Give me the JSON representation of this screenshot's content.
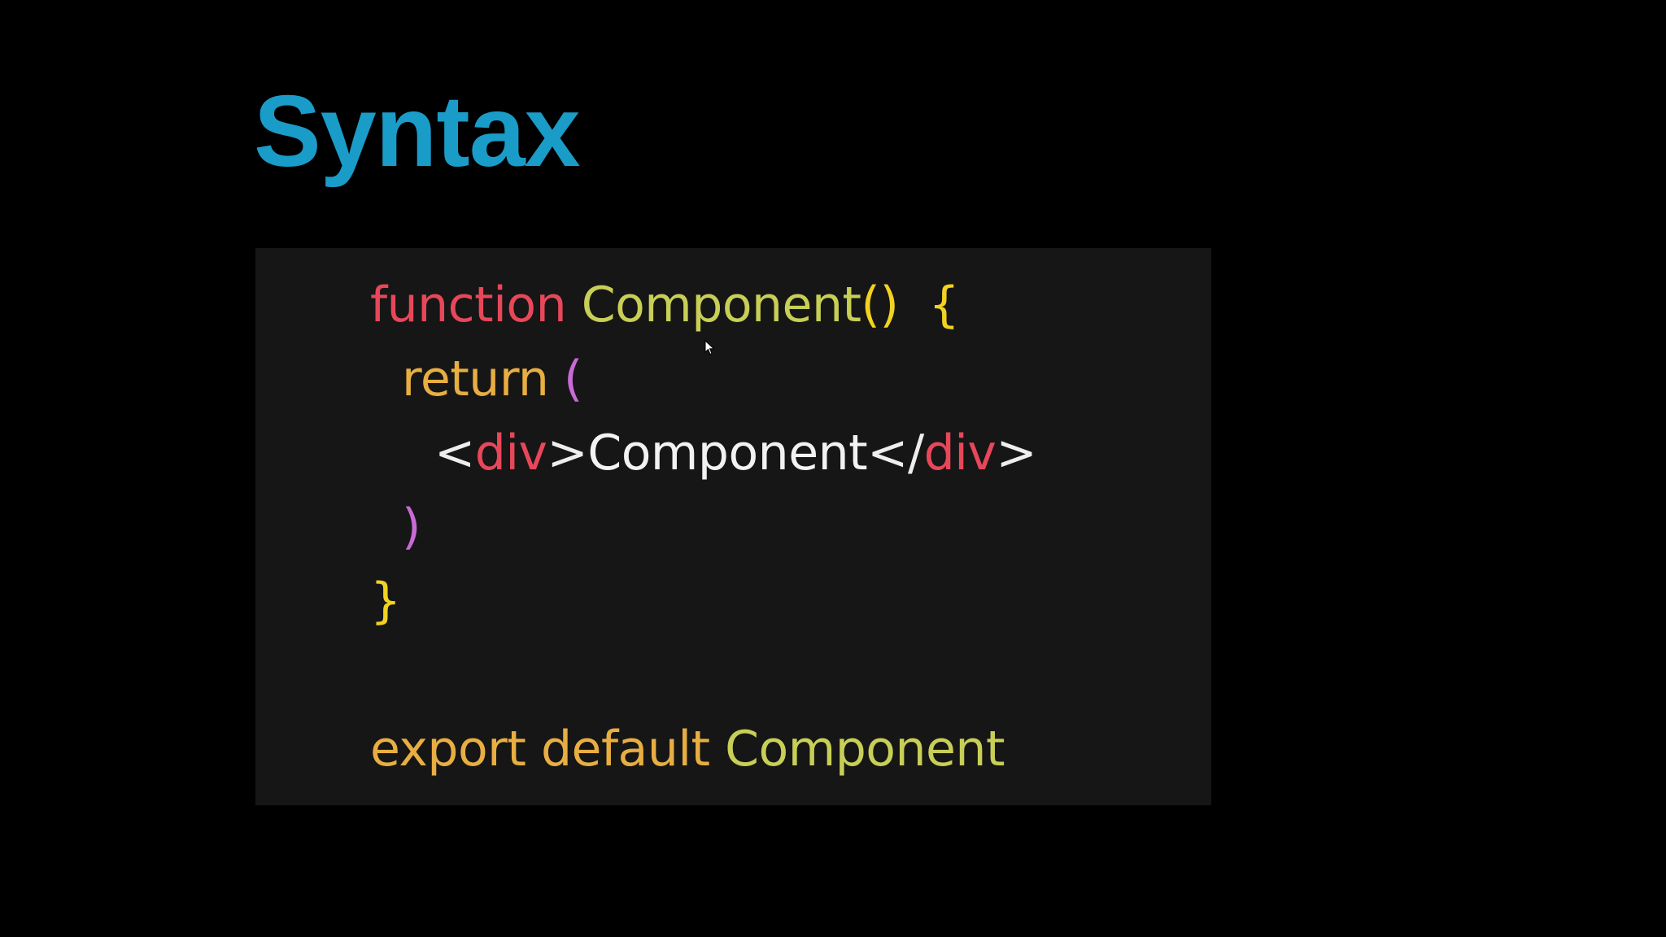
{
  "slide": {
    "title": "Syntax"
  },
  "code": {
    "lines": [
      {
        "tokens": [
          {
            "text": "function",
            "color": "#e8475a"
          },
          {
            "text": " ",
            "color": "#ffffff"
          },
          {
            "text": "Component",
            "color": "#c8cf56"
          },
          {
            "text": "()",
            "color": "#f2d221"
          },
          {
            "text": "  ",
            "color": "#ffffff"
          },
          {
            "text": "{",
            "color": "#f2d221"
          }
        ]
      },
      {
        "tokens": [
          {
            "text": "return",
            "color": "#e8ae42"
          },
          {
            "text": " ",
            "color": "#ffffff"
          },
          {
            "text": "(",
            "color": "#c96ad6"
          }
        ]
      },
      {
        "tokens": [
          {
            "text": "<",
            "color": "#eeeeee"
          },
          {
            "text": "div",
            "color": "#e8475a"
          },
          {
            "text": ">",
            "color": "#eeeeee"
          },
          {
            "text": "Component",
            "color": "#f2f2f2"
          },
          {
            "text": "</",
            "color": "#eeeeee"
          },
          {
            "text": "div",
            "color": "#e8475a"
          },
          {
            "text": ">",
            "color": "#eeeeee"
          }
        ]
      },
      {
        "tokens": [
          {
            "text": ")",
            "color": "#c96ad6"
          }
        ]
      },
      {
        "tokens": [
          {
            "text": "}",
            "color": "#f2d221"
          }
        ]
      },
      {
        "tokens": [
          {
            "text": "export",
            "color": "#e8ae42"
          },
          {
            "text": " ",
            "color": "#ffffff"
          },
          {
            "text": "default",
            "color": "#e8ae42"
          },
          {
            "text": " ",
            "color": "#ffffff"
          },
          {
            "text": "Component",
            "color": "#c8cf56"
          }
        ]
      }
    ]
  },
  "colors": {
    "background": "#000000",
    "title": "#1a9cc8",
    "code_panel_background": "#161616"
  },
  "icons": {
    "cursor": "mouse-pointer-icon"
  }
}
